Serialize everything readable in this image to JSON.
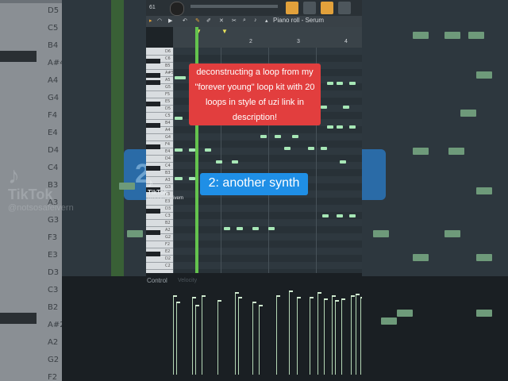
{
  "background": {
    "key_labels": [
      "D5",
      "C5",
      "B4",
      "A#4",
      "A4",
      "G4",
      "F4",
      "E4",
      "D4",
      "C4",
      "B3",
      "A3",
      "G3",
      "F3",
      "E3",
      "D3",
      "C3",
      "B2",
      "A#2",
      "A2",
      "G2",
      "F2"
    ],
    "watermark_brand": "TikTok",
    "watermark_user": "@notsosafeivern",
    "blue_hint": "2:"
  },
  "app": {
    "topbar_number": "61",
    "window_title": "Piano roll - Serum",
    "ruler_numbers": [
      "2",
      "3",
      "4"
    ],
    "key_labels": [
      "D6",
      "C6",
      "B5",
      "A#5",
      "A5",
      "G5",
      "F5",
      "E5",
      "D5",
      "C5",
      "B4",
      "A4",
      "G4",
      "F4",
      "E4",
      "D4",
      "C4",
      "B3",
      "A3",
      "G3",
      "F3",
      "E3",
      "D3",
      "C3",
      "B2",
      "A2",
      "G2",
      "F2",
      "E2",
      "D2",
      "C2"
    ],
    "control_label": "Control",
    "control_sub": "Velocity"
  },
  "overlays": {
    "caption": "deconstructing a loop from my \"forever young\" loop kit with 20 loops in style of uzi link in description!",
    "section_label": "2: another synth",
    "watermark_brand": "TikTok",
    "watermark_user": "@notsosafeivern"
  },
  "colors": {
    "caption_bg": "#e23e3e",
    "section_bg": "#1f8fe6",
    "note": "#a7e7b6",
    "playhead": "#64c34e"
  }
}
